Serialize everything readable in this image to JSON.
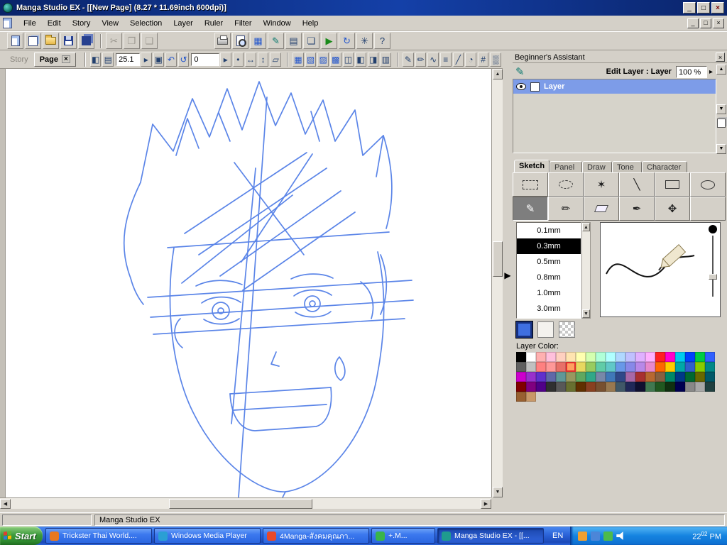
{
  "window": {
    "title": "Manga Studio EX - [[New Page] (8.27 * 11.69inch 600dpi)]",
    "status_text": "Manga Studio EX"
  },
  "menu": {
    "items": [
      "File",
      "Edit",
      "Story",
      "View",
      "Selection",
      "Layer",
      "Ruler",
      "Filter",
      "Window",
      "Help"
    ]
  },
  "toolbar": {
    "story_tab_label": "Story",
    "page_tab_label": "Page",
    "zoom_value": "25.1",
    "rotation_value": "0"
  },
  "icons": {
    "close": "×",
    "win_min": "_",
    "win_max": "□",
    "cut": "✂",
    "copy": "❐",
    "paste": "❑",
    "undo": "↶",
    "redo": "↷",
    "rotate_ccw": "↺",
    "rotate_cw": "↻",
    "material": "▦",
    "story_manager": "▤",
    "layer_manager": "❏",
    "actions": "▶",
    "settings": "✳",
    "assistant": "✎",
    "question": "?",
    "flip": "◧",
    "thumbs": "▤",
    "fit": "▣",
    "dot": "•",
    "h_arrows": "↔",
    "v_arrows": "↕",
    "quad": "▱",
    "grid1": "▦",
    "grid2": "▧",
    "grid3": "▨",
    "grid4": "▩",
    "grid5": "◫",
    "grid6": "◧",
    "grid7": "◨",
    "grid8": "▥",
    "pen1": "✎",
    "pen2": "✏",
    "wave": "∿",
    "lines": "≡",
    "slash": "╱",
    "circle": "◔",
    "hash": "#",
    "tone": "▒",
    "arrow_up": "▲",
    "arrow_down": "▼",
    "arrow_left": "◀",
    "arrow_right": "▶",
    "small_right": "▸",
    "expand": "▶",
    "wand": "✶",
    "line": "╲",
    "pencil": "✎",
    "pen": "✏",
    "brush": "✒",
    "move": "✥"
  },
  "assistant": {
    "title": "Beginner's Assistant",
    "edit_layer_label": "Edit Layer : Layer",
    "opacity_value": "100 %",
    "layer_name": "Layer",
    "tabs": [
      "Sketch",
      "Panel",
      "Draw",
      "Tone",
      "Character"
    ],
    "active_tab": "Sketch",
    "pen_sizes": [
      "0.1mm",
      "0.3mm",
      "0.5mm",
      "0.8mm",
      "1.0mm",
      "3.0mm"
    ],
    "selected_pen_size": "0.3mm",
    "layer_color_label": "Layer Color:"
  },
  "palette": {
    "selected": {
      "row": 1,
      "col": 5
    },
    "rows": [
      [
        "#000000",
        "#ffffff",
        "#ffb0b0",
        "#ffc0dc",
        "#ffd0c0",
        "#ffe4b0",
        "#ffffb0",
        "#d4ffb0",
        "#b0ffd8",
        "#b0ffff",
        "#b0d8ff",
        "#c0c0ff",
        "#e0b0ff",
        "#ffb0ff",
        "#ff2020",
        "#ff00cc",
        "#00ccee",
        "#0040ff",
        "#00cc44",
        "#3060ff"
      ],
      [
        "#606060",
        "#c0c0c0",
        "#ff8080",
        "#ff9898",
        "#e87068",
        "#ffa060",
        "#e8d860",
        "#98cc60",
        "#60cca8",
        "#60c8c8",
        "#6898e8",
        "#8888e8",
        "#b888e8",
        "#e888cc",
        "#ff6600",
        "#ffcc00",
        "#00a8a8",
        "#3060cc",
        "#88cc00",
        "#008888"
      ],
      [
        "#cc00cc",
        "#9830cc",
        "#6030cc",
        "#6068a8",
        "#609898",
        "#989860",
        "#60a860",
        "#30a888",
        "#7888a8",
        "#4078b8",
        "#304888",
        "#a868a8",
        "#a83030",
        "#b86830",
        "#886040",
        "#008868",
        "#003888",
        "#006830",
        "#686800",
        "#005868"
      ],
      [
        "#800000",
        "#800080",
        "#500088",
        "#303030",
        "#585858",
        "#687030",
        "#603000",
        "#884020",
        "#785030",
        "#987850",
        "#405868",
        "#202858",
        "#101030",
        "#407850",
        "#205820",
        "#103010",
        "#000050",
        "#888888",
        "#a8a8a8",
        "#204040"
      ],
      [
        "#986030",
        "#c89868"
      ]
    ]
  },
  "sketch": {
    "stroke": "#5b85e8",
    "width": 1.7,
    "paths": [
      "M190,160 L207,78 L236,116 L263,42 L287,96 L312,28 L333,86 L357,18 L380,80 L402,34 L422,92 L447,44 L464,102 L492,58 L503,122 L532,94 L522,152",
      "M190,160 C168,205 158,248 176,295 C180,310 186,322 194,332",
      "M532,94 C546,140 548,182 536,225",
      "M237,252 C224,330 234,428 266,488 C300,556 358,598 394,596 C450,588 510,518 524,428 C537,358 534,300 524,258",
      "M252,232 L424,118",
      "M272,262 L452,140",
      "M302,292 L472,172",
      "M334,312 L492,202",
      "M248,302 L404,178",
      "M368,40 L328,604",
      "M352,140 L318,500",
      "M200,322 L572,298",
      "M204,350 L574,326",
      "M208,374 L562,352",
      "M268,306 C288,296 314,296 333,304",
      "M402,296 C420,287 446,287 461,295",
      "M276,330 C291,319 316,319 331,329",
      "M279,353 C293,362 315,362 329,352",
      "M315,341 A12,12 0 1,1 291,341 A12,12 0 1,1 315,341",
      "M307,341 A4,4 0 1,1 299,341 A4,4 0 1,1 307,341",
      "M406,320 C420,309 445,309 459,319",
      "M408,343 C421,352 446,352 458,342",
      "M443,331 A11,11 0 1,1 421,331 A11,11 0 1,1 443,331",
      "M436,331 A4,4 0 1,1 428,331 A4,4 0 1,1 436,331",
      "M381,399 L374,416 L385,419",
      "M316,458 L458,449",
      "M316,458 C318,492 332,509 351,510 L437,504 C453,500 461,478 458,449",
      "M321,481 L452,473",
      "M470,406 C479,418 481,432 472,439 C462,432 461,416 470,406",
      "M246,352 C235,362 235,382 249,393",
      "M500,300 C516,312 521,332 515,352",
      "M528,262 C540,292 538,322 528,346",
      "M240,122 L256,70 L272,112",
      "M300,62 L316,102",
      "M430,60 L442,102",
      "M394,596 L390,604",
      "M322,132 L420,262",
      "M432,120 L332,272",
      "M228,252 L540,230"
    ]
  },
  "taskbar": {
    "start_label": "Start",
    "buttons": [
      {
        "label": "Trickster Thai World....",
        "color": "#e87820"
      },
      {
        "label": "Windows Media Player",
        "color": "#2b9fd4"
      },
      {
        "label": "4Manga-สังคมคุณภา...",
        "color": "#e8492a"
      },
      {
        "label": "+.M...",
        "color": "#39b54a"
      },
      {
        "label": "Manga Studio EX - [[...",
        "color": "#1f9b8e"
      }
    ],
    "language": "EN",
    "clock": {
      "hours": "22",
      "minutes": "02",
      "period": "PM"
    }
  }
}
